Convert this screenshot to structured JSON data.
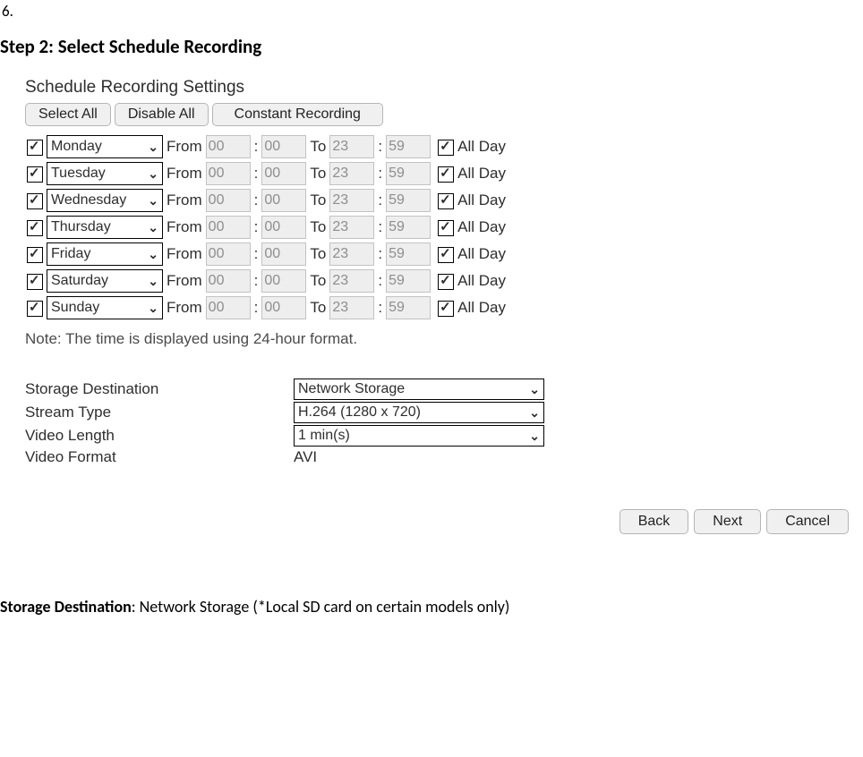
{
  "page_number": "6.",
  "step_title": "Step 2: Select Schedule Recording",
  "panel_title": "Schedule Recording Settings",
  "buttons": {
    "select_all": "Select All",
    "disable_all": "Disable All",
    "constant_recording": "Constant Recording",
    "back": "Back",
    "next": "Next",
    "cancel": "Cancel"
  },
  "labels": {
    "from": "From",
    "to": "To",
    "all_day": "All Day",
    "colon": ":"
  },
  "schedule": [
    {
      "enabled": true,
      "day": "Monday",
      "from_h": "00",
      "from_m": "00",
      "to_h": "23",
      "to_m": "59",
      "all_day": true
    },
    {
      "enabled": true,
      "day": "Tuesday",
      "from_h": "00",
      "from_m": "00",
      "to_h": "23",
      "to_m": "59",
      "all_day": true
    },
    {
      "enabled": true,
      "day": "Wednesday",
      "from_h": "00",
      "from_m": "00",
      "to_h": "23",
      "to_m": "59",
      "all_day": true
    },
    {
      "enabled": true,
      "day": "Thursday",
      "from_h": "00",
      "from_m": "00",
      "to_h": "23",
      "to_m": "59",
      "all_day": true
    },
    {
      "enabled": true,
      "day": "Friday",
      "from_h": "00",
      "from_m": "00",
      "to_h": "23",
      "to_m": "59",
      "all_day": true
    },
    {
      "enabled": true,
      "day": "Saturday",
      "from_h": "00",
      "from_m": "00",
      "to_h": "23",
      "to_m": "59",
      "all_day": true
    },
    {
      "enabled": true,
      "day": "Sunday",
      "from_h": "00",
      "from_m": "00",
      "to_h": "23",
      "to_m": "59",
      "all_day": true
    }
  ],
  "note": "Note: The time is displayed using 24-hour format.",
  "settings": {
    "storage_destination_label": "Storage Destination",
    "storage_destination_value": "Network Storage",
    "stream_type_label": "Stream Type",
    "stream_type_value": "H.264 (1280 x 720)",
    "video_length_label": "Video Length",
    "video_length_value": "1 min(s)",
    "video_format_label": "Video Format",
    "video_format_value": "AVI"
  },
  "footer": {
    "bold": "Storage Destination",
    "rest": ": Network Storage (*Local SD card on certain models only)"
  }
}
